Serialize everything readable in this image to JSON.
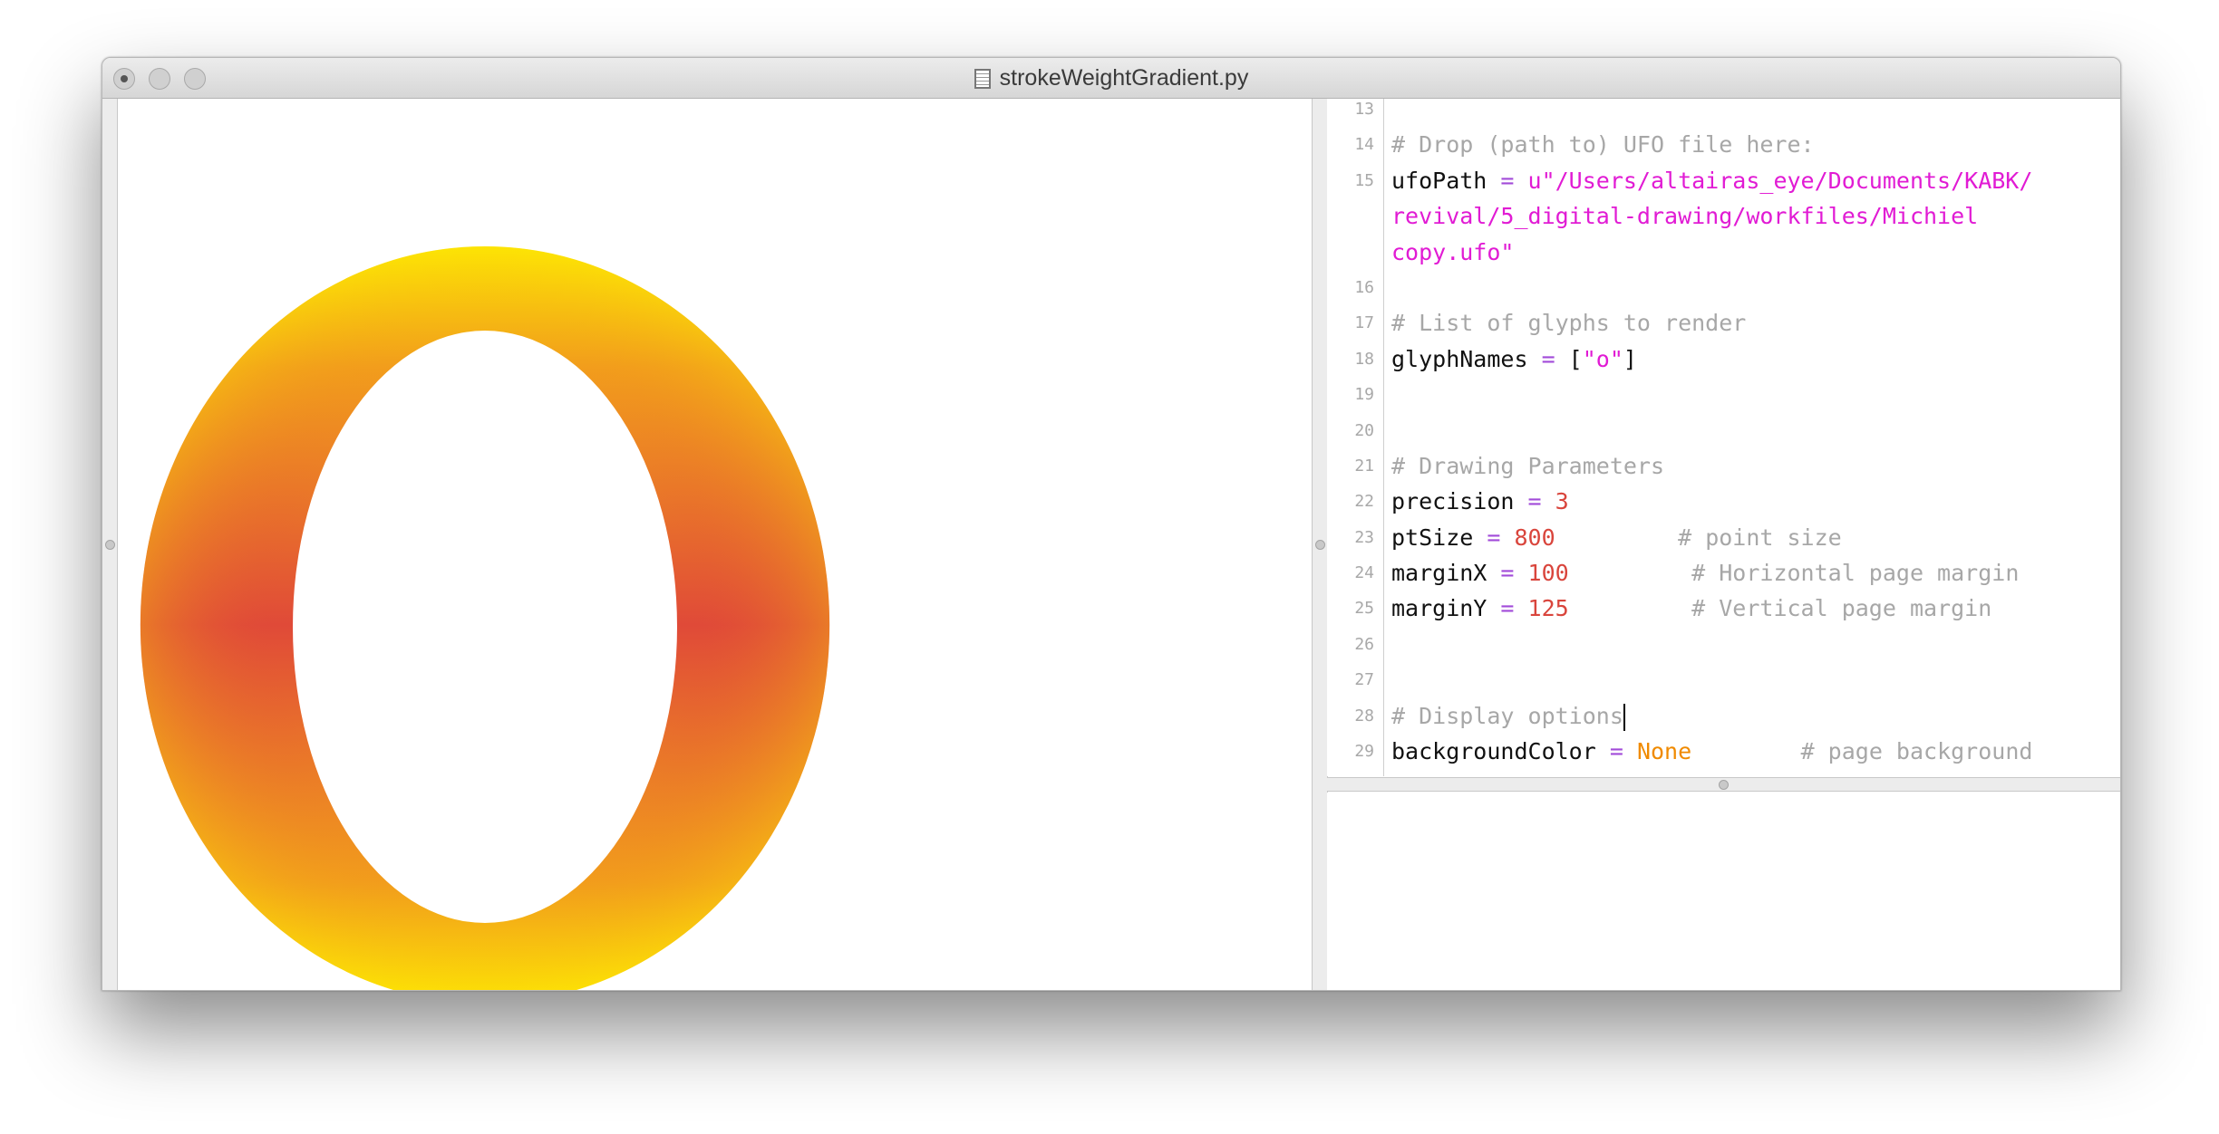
{
  "window": {
    "title": "strokeWeightGradient.py",
    "controls": [
      "close",
      "minimize",
      "zoom"
    ]
  },
  "canvas": {
    "glyph": "o",
    "gradient_colors": {
      "yellow": "#fff000",
      "orange": "#f08a1c",
      "red": "#e04a38"
    },
    "background": "#ffffff"
  },
  "editor": {
    "lines": [
      {
        "n": "13",
        "parts": []
      },
      {
        "n": "14",
        "parts": [
          {
            "t": "# Drop (path to) UFO file here:",
            "c": "com"
          }
        ]
      },
      {
        "n": "15",
        "parts": [
          {
            "t": "ufoPath",
            "c": ""
          },
          {
            "t": " = ",
            "c": "op"
          },
          {
            "t": "u\"/Users/altairas_eye/Documents/KABK/",
            "c": "str"
          }
        ]
      },
      {
        "n": "",
        "parts": [
          {
            "t": "revival/5_digital-drawing/workfiles/Michiel",
            "c": "str"
          }
        ]
      },
      {
        "n": "",
        "parts": [
          {
            "t": "copy.ufo\"",
            "c": "str"
          }
        ]
      },
      {
        "n": "16",
        "parts": []
      },
      {
        "n": "17",
        "parts": [
          {
            "t": "# List of glyphs to render",
            "c": "com"
          }
        ]
      },
      {
        "n": "18",
        "parts": [
          {
            "t": "glyphNames",
            "c": ""
          },
          {
            "t": " = ",
            "c": "op"
          },
          {
            "t": "[",
            "c": ""
          },
          {
            "t": "\"o\"",
            "c": "str"
          },
          {
            "t": "]",
            "c": ""
          }
        ]
      },
      {
        "n": "19",
        "parts": []
      },
      {
        "n": "20",
        "parts": []
      },
      {
        "n": "21",
        "parts": [
          {
            "t": "# Drawing Parameters",
            "c": "com"
          }
        ]
      },
      {
        "n": "22",
        "parts": [
          {
            "t": "precision",
            "c": ""
          },
          {
            "t": " = ",
            "c": "op"
          },
          {
            "t": "3",
            "c": "num"
          }
        ]
      },
      {
        "n": "23",
        "parts": [
          {
            "t": "ptSize",
            "c": ""
          },
          {
            "t": " = ",
            "c": "op"
          },
          {
            "t": "800",
            "c": "num"
          },
          {
            "t": "         # point size",
            "c": "com"
          }
        ]
      },
      {
        "n": "24",
        "parts": [
          {
            "t": "marginX",
            "c": ""
          },
          {
            "t": " = ",
            "c": "op"
          },
          {
            "t": "100",
            "c": "num"
          },
          {
            "t": "         # Horizontal page margin",
            "c": "com"
          }
        ]
      },
      {
        "n": "25",
        "parts": [
          {
            "t": "marginY",
            "c": ""
          },
          {
            "t": " = ",
            "c": "op"
          },
          {
            "t": "125",
            "c": "num"
          },
          {
            "t": "         # Vertical page margin",
            "c": "com"
          }
        ]
      },
      {
        "n": "26",
        "parts": []
      },
      {
        "n": "27",
        "parts": []
      },
      {
        "n": "28",
        "parts": [
          {
            "t": "# Display options",
            "c": "com"
          },
          {
            "t": "",
            "c": "caret"
          }
        ]
      },
      {
        "n": "29",
        "parts": [
          {
            "t": "backgroundColor",
            "c": ""
          },
          {
            "t": " = ",
            "c": "op"
          },
          {
            "t": "None",
            "c": "kw"
          },
          {
            "t": "        # page background",
            "c": "com"
          }
        ]
      }
    ]
  },
  "output": {
    "text": ""
  }
}
